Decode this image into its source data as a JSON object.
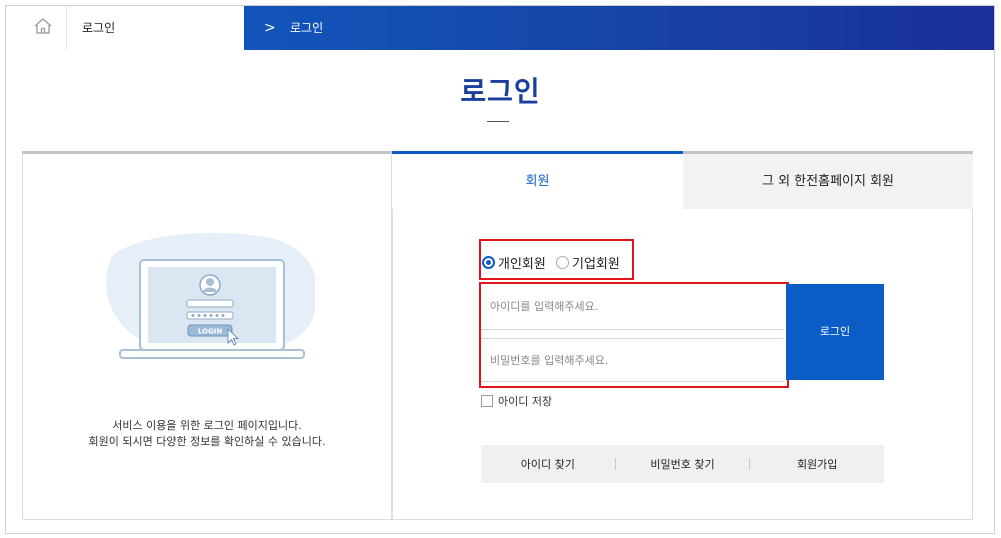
{
  "breadcrumb": {
    "home_icon": "home-icon",
    "current_section": "로그인",
    "separator": ">",
    "current_page": "로그인"
  },
  "page_title": "로그인",
  "left_panel": {
    "illustration_button": "LOGIN",
    "description_line1": "서비스 이용을 위한 로그인 페이지입니다.",
    "description_line2": "회원이 되시면 다양한 정보를 확인하실 수 있습니다."
  },
  "tabs": [
    {
      "label": "회원",
      "active": true
    },
    {
      "label": "그 외 한전홈페이지 회원",
      "active": false
    }
  ],
  "member_type": {
    "options": [
      {
        "label": "개인회원",
        "selected": true
      },
      {
        "label": "기업회원",
        "selected": false
      }
    ]
  },
  "form": {
    "id_placeholder": "아이디를 입력해주세요.",
    "pw_placeholder": "비밀번호를 입력해주세요.",
    "login_label": "로그인",
    "save_id_label": "아이디 저장"
  },
  "links": [
    {
      "label": "아이디 찾기"
    },
    {
      "label": "비밀번호 찾기"
    },
    {
      "label": "회원가입"
    }
  ],
  "colors": {
    "accent": "#0b5cc4",
    "title": "#1a3e9c",
    "highlight": "#e0161e"
  }
}
